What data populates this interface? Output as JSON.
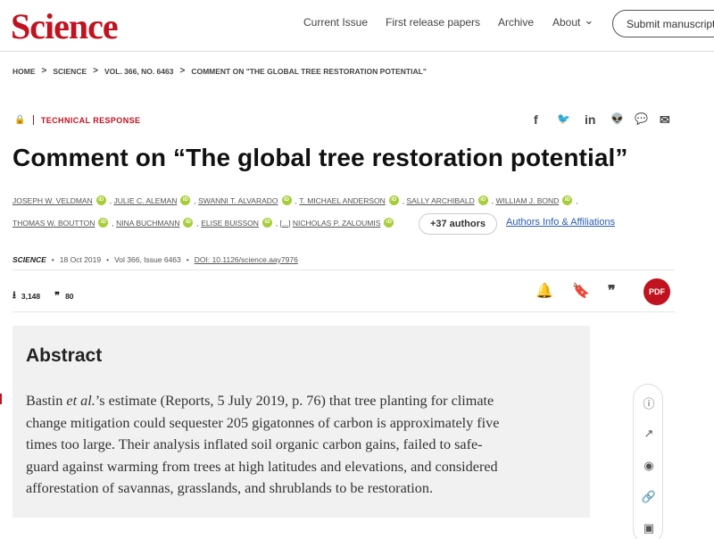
{
  "header": {
    "logo": "Science",
    "nav": [
      "Current Issue",
      "First release papers",
      "Archive",
      "About"
    ],
    "about_chevron": "⌄",
    "submit": "Submit manuscript"
  },
  "breadcrumb": [
    "HOME",
    "SCIENCE",
    "VOL. 366, NO. 6463",
    "COMMENT ON \"THE GLOBAL TREE RESTORATION POTENTIAL\""
  ],
  "breadcrumb_sep": ">",
  "article": {
    "type": "TECHNICAL RESPONSE",
    "title": "Comment on “The global tree restoration potential”",
    "authors_row1": [
      "JOSEPH W. VELDMAN",
      "JULIE C. ALEMAN",
      "SWANNI T. ALVARADO",
      "T. MICHAEL ANDERSON",
      "SALLY ARCHIBALD",
      "WILLIAM J. BOND"
    ],
    "authors_row2": [
      "THOMAS W. BOUTTON",
      "NINA BUCHMANN",
      "ELISE BUISSON",
      "[...]",
      "NICHOLAS P. ZALOUMIS"
    ],
    "more_authors": "+37 authors",
    "affiliations": "Authors Info & Affiliations",
    "meta": {
      "journal": "SCIENCE",
      "date": "18 Oct 2019",
      "volume": "Vol 366, Issue 6463",
      "doi": "DOI: 10.1126/science.aay7976"
    },
    "metrics": {
      "downloads": "3,148",
      "citations": "80"
    }
  },
  "abstract": {
    "heading": "Abstract",
    "lines": [
      "Bastin et al.’s estimate (Reports, 5 July 2019, p. 76) that tree planting for climate",
      "change mitigation could sequester 205 gigatonnes of carbon is approximately five",
      "times too large. Their analysis inflated soil organic carbon gains, failed to safe-",
      "guard against warming from trees at high latitudes and elevations, and considered",
      "afforestation of savannas, grasslands, and shrublands to be restoration."
    ]
  },
  "icons": {
    "lock": "🔒",
    "share": [
      "f",
      "🐦",
      "in",
      "👽",
      "💬",
      "✉"
    ],
    "download": "⭳",
    "quote": "❞",
    "bell": "🔔",
    "bookmark": "🔖",
    "cite": "❞",
    "pdf": "PDF",
    "tools": [
      "ⓘ",
      "↗",
      "◉",
      "🔗",
      "▣"
    ]
  },
  "colors": {
    "brand": "#c1121f",
    "link": "#2a5db0",
    "orcid": "#a6ce39",
    "abstract_bg": "#f1f1f1"
  }
}
